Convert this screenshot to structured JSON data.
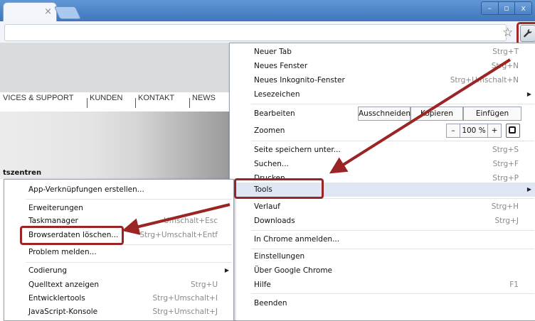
{
  "window": {
    "tab_close": "×",
    "controls": {
      "minimize": "–",
      "maximize": "▫",
      "close": "x"
    }
  },
  "toolbar": {
    "star_glyph": "☆",
    "wrench_glyph": "🔧"
  },
  "page": {
    "nav": [
      "VICES & SUPPORT",
      "KUNDEN",
      "KONTAKT",
      "NEWS"
    ],
    "hero_label": "tszentren"
  },
  "main_menu": {
    "items": [
      {
        "label": "Neuer Tab",
        "shortcut": "Strg+T"
      },
      {
        "label": "Neues Fenster",
        "shortcut": "Strg+N"
      },
      {
        "label": "Neues Inkognito-Fenster",
        "shortcut": "Strg+Umschalt+N"
      },
      {
        "label": "Lesezeichen",
        "submenu": true
      }
    ],
    "edit": {
      "label": "Bearbeiten",
      "cut": "Ausschneiden",
      "copy": "Kopieren",
      "paste": "Einfügen"
    },
    "zoom": {
      "label": "Zoomen",
      "minus": "–",
      "value": "100 %",
      "plus": "+"
    },
    "items2": [
      {
        "label": "Seite speichern unter...",
        "shortcut": "Strg+S"
      },
      {
        "label": "Suchen...",
        "shortcut": "Strg+F"
      },
      {
        "label": "Drucken...",
        "shortcut": "Strg+P"
      },
      {
        "label": "Tools",
        "submenu": true
      }
    ],
    "items3": [
      {
        "label": "Verlauf",
        "shortcut": "Strg+H"
      },
      {
        "label": "Downloads",
        "shortcut": "Strg+J"
      }
    ],
    "signin": "In Chrome anmelden...",
    "items4": [
      {
        "label": "Einstellungen"
      },
      {
        "label": "Über Google Chrome"
      },
      {
        "label": "Hilfe",
        "shortcut": "F1"
      }
    ],
    "quit": "Beenden"
  },
  "tools_menu": {
    "create_shortcuts": "App-Verknüpfungen erstellen...",
    "extensions": "Erweiterungen",
    "task_manager": {
      "label": "Taskmanager",
      "shortcut": "Umschalt+Esc"
    },
    "clear_data": {
      "label": "Browserdaten löschen...",
      "shortcut": "Strg+Umschalt+Entf"
    },
    "report": "Problem melden...",
    "encoding": "Codierung",
    "view_source": {
      "label": "Quelltext anzeigen",
      "shortcut": "Strg+U"
    },
    "dev_tools": {
      "label": "Entwicklertools",
      "shortcut": "Strg+Umschalt+I"
    },
    "js_console": {
      "label": "JavaScript-Konsole",
      "shortcut": "Strg+Umschalt+J"
    }
  },
  "colors": {
    "annotation": "#9b2424",
    "titlebar": "#4a83c8"
  }
}
